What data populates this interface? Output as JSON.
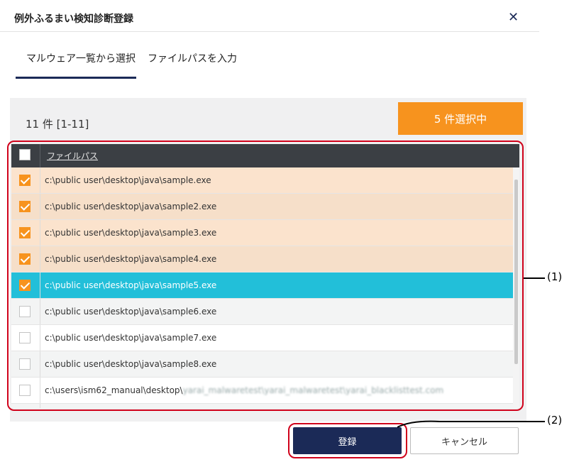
{
  "dialog": {
    "title": "例外ふるまい検知診断登録",
    "close_glyph": "✕"
  },
  "tabs": [
    {
      "label": "マルウェア一覧から選択",
      "active": true
    },
    {
      "label": "ファイルパスを入力",
      "active": false
    }
  ],
  "summary": {
    "count_text": "11 件  [1-11]",
    "selected_text": "5 件選択中"
  },
  "table": {
    "column_header": "ファイルパス",
    "rows": [
      {
        "path": "c:\\public user\\desktop\\java\\sample.exe",
        "checked": true
      },
      {
        "path": "c:\\public user\\desktop\\java\\sample2.exe",
        "checked": true
      },
      {
        "path": "c:\\public user\\desktop\\java\\sample3.exe",
        "checked": true
      },
      {
        "path": "c:\\public user\\desktop\\java\\sample4.exe",
        "checked": true
      },
      {
        "path": "c:\\public user\\desktop\\java\\sample5.exe",
        "checked": true
      },
      {
        "path": "c:\\public user\\desktop\\java\\sample6.exe",
        "checked": false
      },
      {
        "path": "c:\\public user\\desktop\\java\\sample7.exe",
        "checked": false
      },
      {
        "path": "c:\\public user\\desktop\\java\\sample8.exe",
        "checked": false
      },
      {
        "path": "c:\\users\\ism62_manual\\desktop\\",
        "path_blurred": "yarai_malwaretest\\yarai_malwaretest\\yarai_blacklisttest.com",
        "checked": false
      }
    ]
  },
  "buttons": {
    "register": "登録",
    "cancel": "キャンセル"
  },
  "callouts": {
    "one": "(1)",
    "two": "(2)"
  },
  "colors": {
    "accent_orange": "#f7931e",
    "navy": "#1b2a57",
    "active_row": "#22bfd9",
    "annotation_red": "#d0021b"
  }
}
